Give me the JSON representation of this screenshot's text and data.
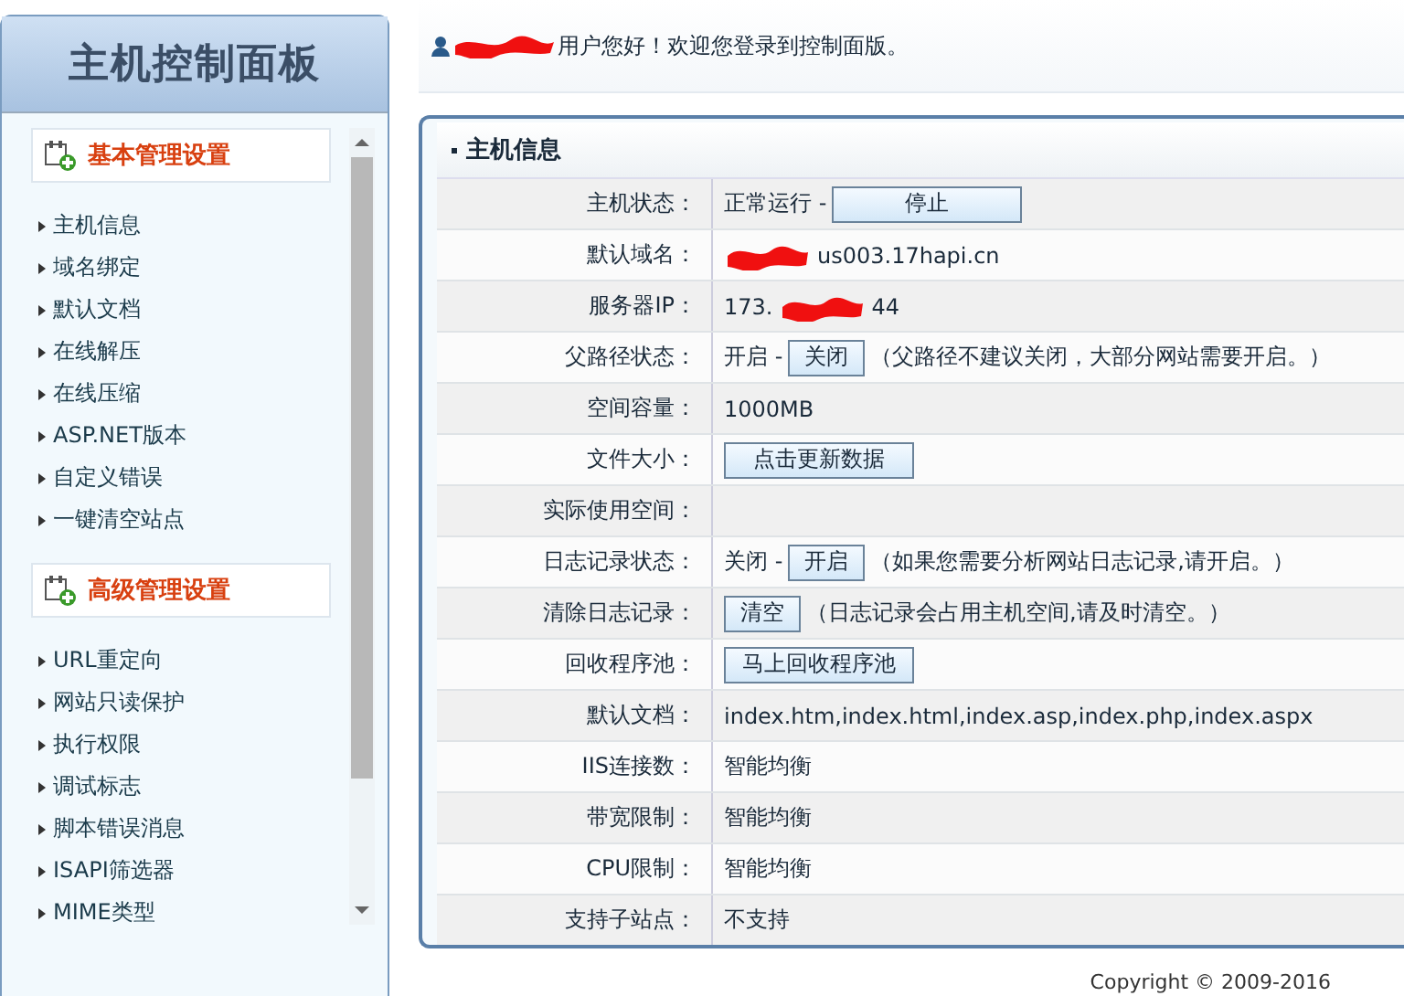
{
  "sidebar": {
    "title": "主机控制面板",
    "sections": [
      {
        "heading": "基本管理设置",
        "items": [
          "主机信息",
          "域名绑定",
          "默认文档",
          "在线解压",
          "在线压缩",
          "ASP.NET版本",
          "自定义错误",
          "一键清空站点"
        ]
      },
      {
        "heading": "高级管理设置",
        "items": [
          "URL重定向",
          "网站只读保护",
          "执行权限",
          "调试标志",
          "脚本错误消息",
          "ISAPI筛选器",
          "MIME类型"
        ]
      }
    ]
  },
  "greeting": {
    "text": "用户您好！欢迎您登录到控制面版。"
  },
  "panel": {
    "title": "主机信息",
    "rows": [
      {
        "label": "主机状态：",
        "parts": [
          {
            "kind": "text",
            "text": "正常运行 -"
          },
          {
            "kind": "wide_button",
            "text": "停止"
          }
        ]
      },
      {
        "label": "默认域名：",
        "parts": [
          {
            "kind": "redaction"
          },
          {
            "kind": "text",
            "text": "us003.17hapi.cn"
          }
        ]
      },
      {
        "label": "服务器IP：",
        "parts": [
          {
            "kind": "text",
            "text": "173."
          },
          {
            "kind": "redaction"
          },
          {
            "kind": "text",
            "text": "44"
          }
        ]
      },
      {
        "label": "父路径状态：",
        "parts": [
          {
            "kind": "text",
            "text": "开启 -"
          },
          {
            "kind": "button",
            "text": "关闭"
          },
          {
            "kind": "text",
            "text": "（父路径不建议关闭，大部分网站需要开启。）"
          }
        ]
      },
      {
        "label": "空间容量：",
        "parts": [
          {
            "kind": "text",
            "text": "1000MB"
          }
        ]
      },
      {
        "label": "文件大小：",
        "parts": [
          {
            "kind": "wide_button",
            "text": "点击更新数据"
          }
        ]
      },
      {
        "label": "实际使用空间：",
        "parts": []
      },
      {
        "label": "日志记录状态：",
        "parts": [
          {
            "kind": "text",
            "text": "关闭 -"
          },
          {
            "kind": "button",
            "text": "开启"
          },
          {
            "kind": "text",
            "text": "（如果您需要分析网站日志记录,请开启。）"
          }
        ]
      },
      {
        "label": "清除日志记录：",
        "parts": [
          {
            "kind": "button",
            "text": "清空"
          },
          {
            "kind": "text",
            "text": "（日志记录会占用主机空间,请及时清空。）"
          }
        ]
      },
      {
        "label": "回收程序池：",
        "parts": [
          {
            "kind": "wide_button",
            "text": "马上回收程序池"
          }
        ]
      },
      {
        "label": "默认文档：",
        "parts": [
          {
            "kind": "text",
            "text": "index.htm,index.html,index.asp,index.php,index.aspx"
          }
        ]
      },
      {
        "label": "IIS连接数：",
        "parts": [
          {
            "kind": "text",
            "text": "智能均衡"
          }
        ]
      },
      {
        "label": "带宽限制：",
        "parts": [
          {
            "kind": "text",
            "text": "智能均衡"
          }
        ]
      },
      {
        "label": "CPU限制：",
        "parts": [
          {
            "kind": "text",
            "text": "智能均衡"
          }
        ]
      },
      {
        "label": "支持子站点：",
        "parts": [
          {
            "kind": "text",
            "text": "不支持"
          }
        ]
      }
    ]
  },
  "footer": "Copyright © 2009-2016"
}
